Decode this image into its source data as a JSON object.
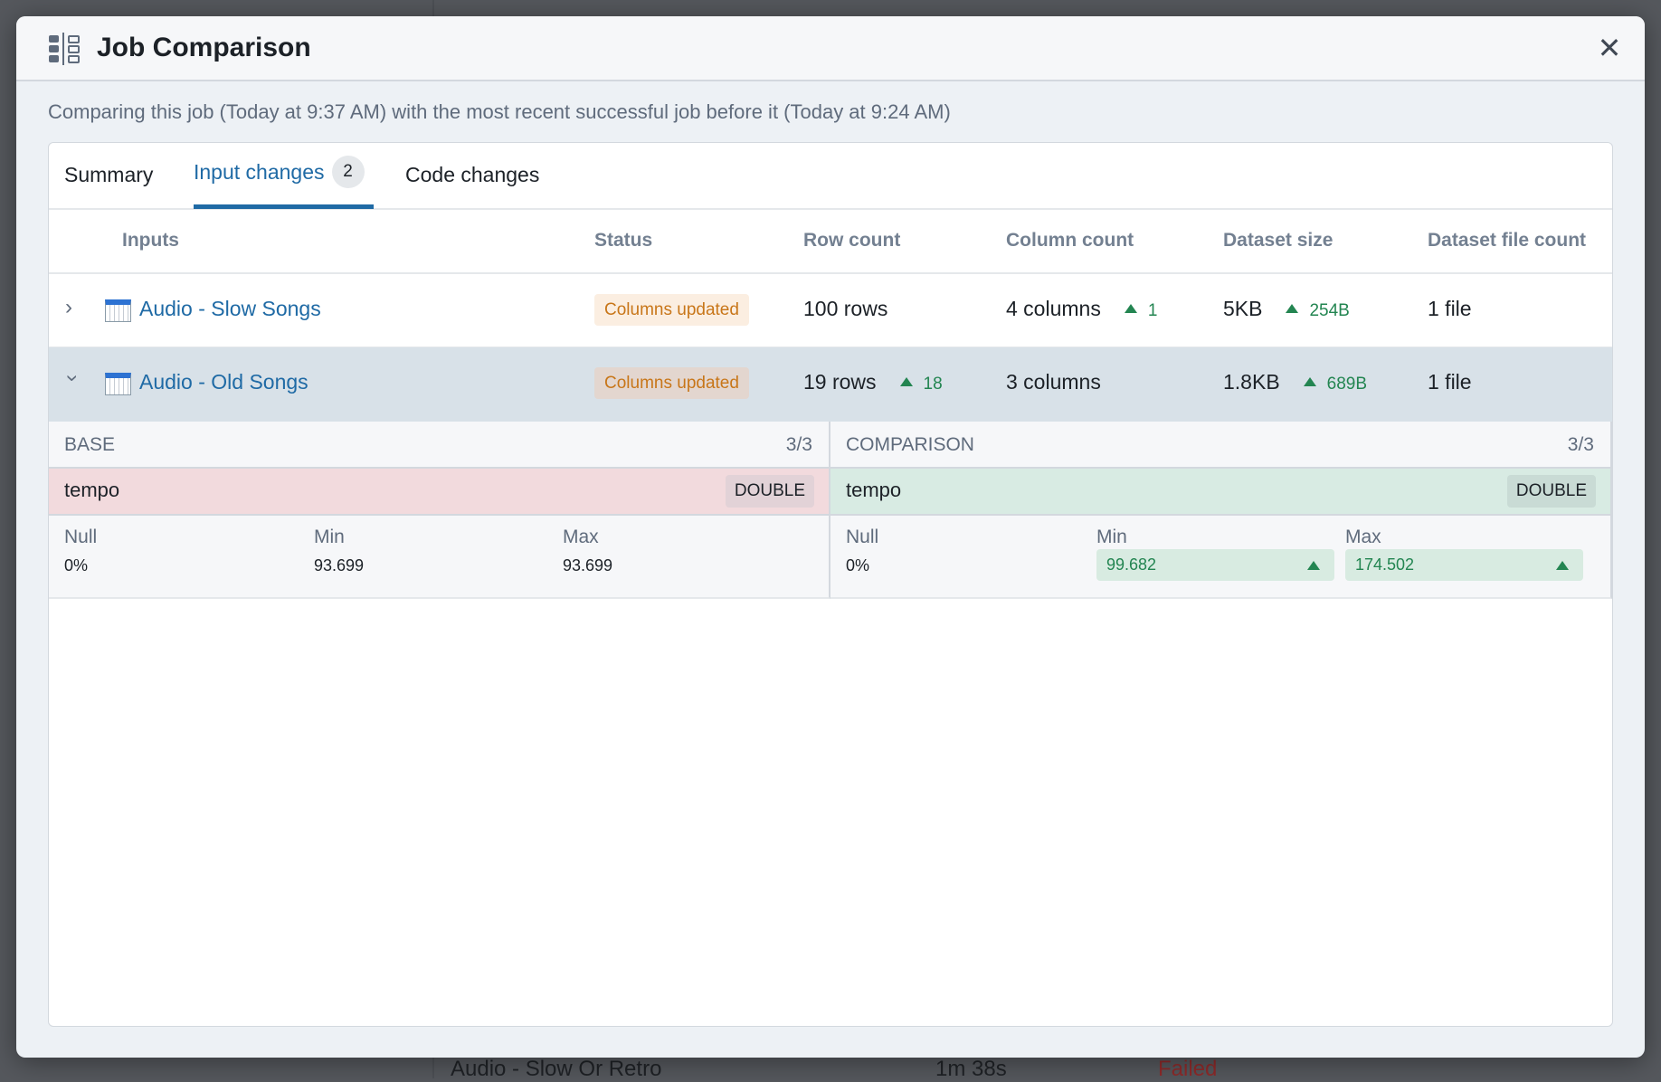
{
  "background": {
    "row_name": "Audio - Slow Or Retro",
    "row_duration": "1m 38s",
    "row_status": "Failed"
  },
  "dialog": {
    "title": "Job Comparison",
    "title_icon": "comparison-columns-icon",
    "close_icon": "close-icon",
    "subtitle": "Comparing this job (Today at 9:37 AM) with the most recent successful job before it (Today at 9:24 AM)"
  },
  "tabs": [
    {
      "label": "Summary",
      "active": false
    },
    {
      "label": "Input changes",
      "badge": "2",
      "active": true
    },
    {
      "label": "Code changes",
      "active": false
    }
  ],
  "table": {
    "headers": [
      "Inputs",
      "Status",
      "Row count",
      "Column count",
      "Dataset size",
      "Dataset file count"
    ],
    "rows": [
      {
        "expanded": false,
        "name": "Audio - Slow Songs",
        "status": "Columns updated",
        "row_count": "100 rows",
        "row_delta": "",
        "column_count": "4 columns",
        "column_delta": "1",
        "size": "5KB",
        "size_delta": "254B",
        "file_count": "1 file"
      },
      {
        "expanded": true,
        "name": "Audio - Old Songs",
        "status": "Columns updated",
        "row_count": "19 rows",
        "row_delta": "18",
        "column_count": "3 columns",
        "column_delta": "",
        "size": "1.8KB",
        "size_delta": "689B",
        "file_count": "1 file"
      }
    ]
  },
  "detail": {
    "base": {
      "label": "BASE",
      "count": "3/3",
      "column": "tempo",
      "type": "DOUBLE",
      "stats": {
        "null_label": "Null",
        "null": "0%",
        "min_label": "Min",
        "min": "93.699",
        "max_label": "Max",
        "max": "93.699"
      }
    },
    "comparison": {
      "label": "COMPARISON",
      "count": "3/3",
      "column": "tempo",
      "type": "DOUBLE",
      "stats": {
        "null_label": "Null",
        "null": "0%",
        "min_label": "Min",
        "min": "99.682",
        "max_label": "Max",
        "max": "174.502"
      }
    }
  },
  "colors": {
    "accent": "#1f6aa5",
    "increase": "#238551",
    "warning": "#c87619",
    "removed_bg": "#f2dadd",
    "added_bg": "#d8ebe3"
  }
}
